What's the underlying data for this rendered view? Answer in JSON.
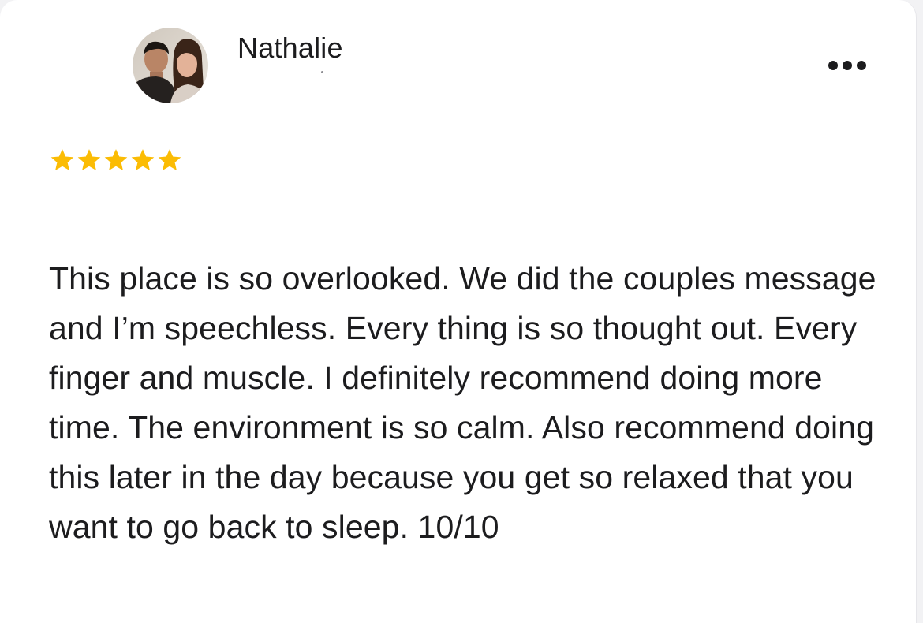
{
  "review": {
    "author_name": "Nathalie",
    "avatar_icon": "profile-photo",
    "rating": 5,
    "max_rating": 5,
    "star_color": "#FBBC04",
    "more_icon": "ellipsis-horizontal-icon",
    "text": "This place is so overlooked. We did the couples message and I’m speechless. Every thing is so thought out. Every finger and muscle. I definitely recommend doing more time. The environment is so calm. Also recommend doing this later in the day because you get so relaxed that you want to go back to sleep. 10/10"
  }
}
